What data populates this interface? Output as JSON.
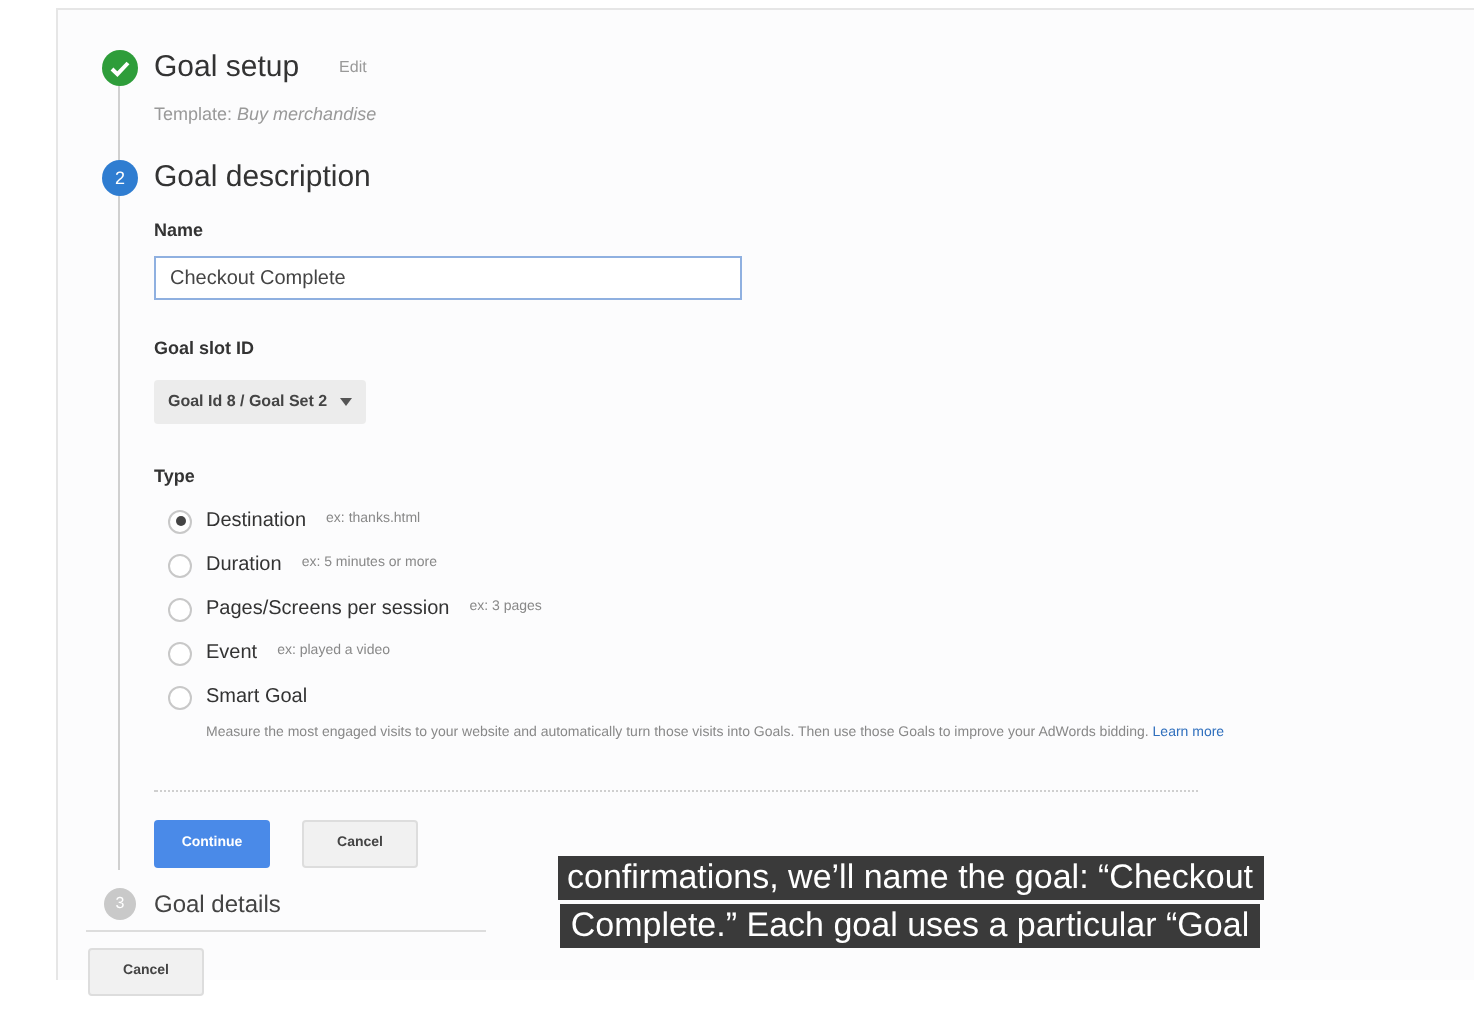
{
  "steps": [
    {
      "kind": "done",
      "title": "Goal setup",
      "action": "Edit",
      "template_label": "Template:",
      "template_value": "Buy merchandise"
    },
    {
      "kind": "active",
      "number": "2",
      "title": "Goal description"
    },
    {
      "kind": "pending",
      "number": "3",
      "title": "Goal details"
    }
  ],
  "name_field": {
    "label": "Name",
    "value": "Checkout Complete"
  },
  "slot": {
    "label": "Goal slot ID",
    "value": "Goal Id 8 / Goal Set 2"
  },
  "type": {
    "label": "Type",
    "options": [
      {
        "label": "Destination",
        "example": "ex: thanks.html",
        "selected": true
      },
      {
        "label": "Duration",
        "example": "ex: 5 minutes or more",
        "selected": false
      },
      {
        "label": "Pages/Screens per session",
        "example": "ex: 3 pages",
        "selected": false
      },
      {
        "label": "Event",
        "example": "ex: played a video",
        "selected": false
      },
      {
        "label": "Smart Goal",
        "selected": false,
        "description": "Measure the most engaged visits to your website and automatically turn those visits into Goals. Then use those Goals to improve your AdWords bidding.",
        "link": "Learn more"
      }
    ]
  },
  "buttons": {
    "continue": "Continue",
    "cancel": "Cancel"
  },
  "footer_cancel": "Cancel",
  "caption": [
    "confirmations, we’ll name the goal: “Checkout",
    "Complete.” Each goal uses a particular “Goal"
  ]
}
